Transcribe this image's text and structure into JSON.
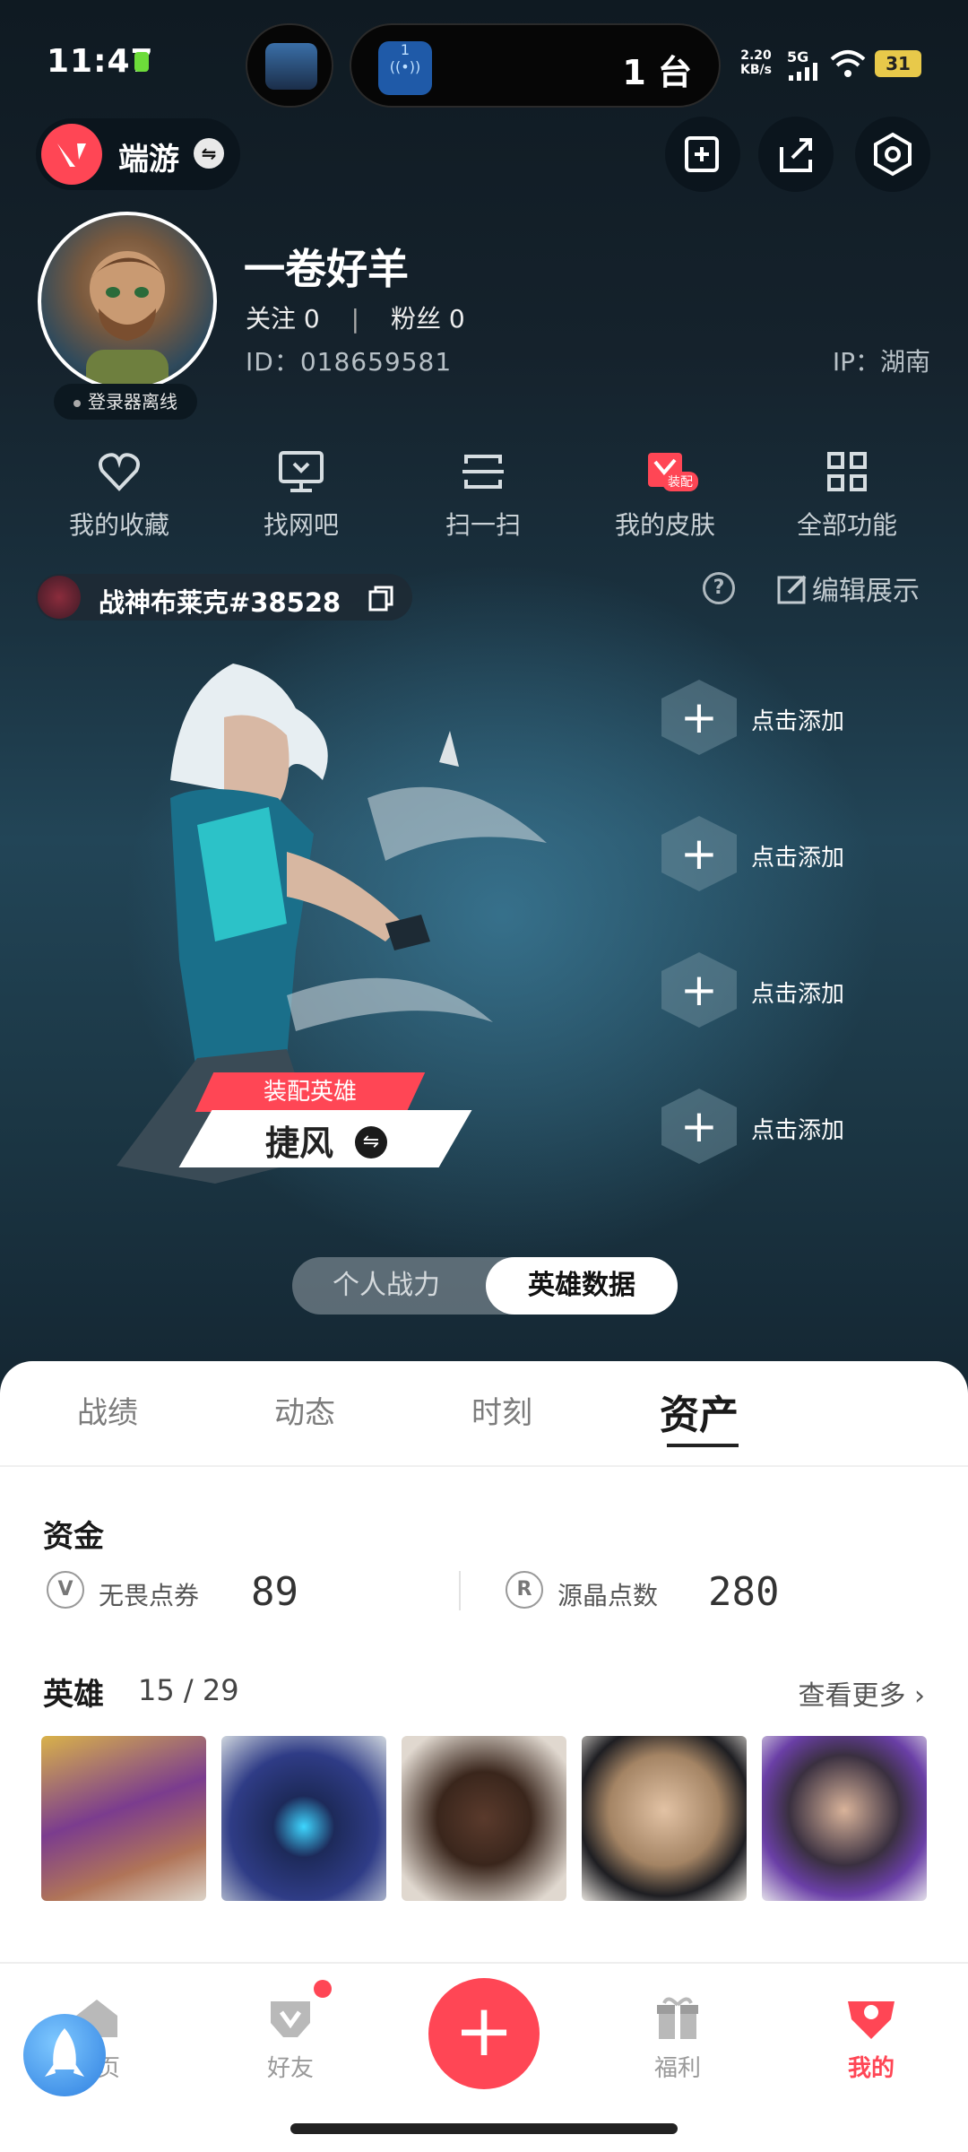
{
  "status": {
    "time": "11:47",
    "net_speed": "2.20\nKB/s",
    "net_type": "5G",
    "battery": "31",
    "island_count": "1 台",
    "island_badge": "1"
  },
  "header": {
    "game_label": "端游",
    "swap_icon": "⇋"
  },
  "profile": {
    "name": "一卷好羊",
    "follow": "关注 0",
    "fans": "粉丝 0",
    "separator": "|",
    "id": "ID：018659581",
    "ip": "IP：湖南",
    "offline": "登录器离线"
  },
  "quick": [
    {
      "label": "我的收藏"
    },
    {
      "label": "找网吧"
    },
    {
      "label": "扫一扫"
    },
    {
      "label": "我的皮肤",
      "badge": "装配"
    },
    {
      "label": "全部功能"
    }
  ],
  "riot_id": "战神布莱克#38528",
  "edit_label": "编辑展示",
  "help_icon": "?",
  "slots": {
    "add_label": "点击添加",
    "plus": "+"
  },
  "equip": {
    "tag": "装配英雄",
    "agent": "捷风"
  },
  "toggle": {
    "left": "个人战力",
    "right": "英雄数据"
  },
  "tabs": [
    {
      "label": "战绩"
    },
    {
      "label": "动态"
    },
    {
      "label": "时刻"
    },
    {
      "label": "资产"
    }
  ],
  "assets": {
    "title": "资金",
    "currencies": [
      {
        "icon": "V",
        "label": "无畏点券",
        "value": "89"
      },
      {
        "icon": "R",
        "label": "源晶点数",
        "value": "280"
      }
    ]
  },
  "heroes": {
    "title": "英雄",
    "owned": "15",
    "total": "29",
    "count": "15 / 29",
    "more": "查看更多 ›"
  },
  "nav": [
    {
      "label": "首页"
    },
    {
      "label": "好友"
    },
    {
      "label": "福利"
    },
    {
      "label": "我的"
    }
  ],
  "colors": {
    "accent": "#ff4655",
    "bg": "#15222c"
  }
}
